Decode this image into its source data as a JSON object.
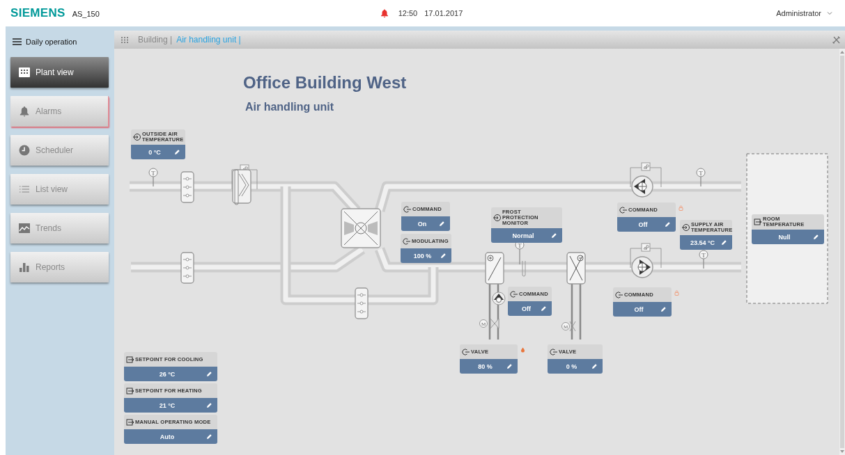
{
  "header": {
    "logo": "SIEMENS",
    "device": "AS_150",
    "time": "12:50",
    "date": "17.01.2017",
    "user": "Administrator"
  },
  "sidebar": {
    "title": "Daily operation",
    "items": [
      {
        "label": "Plant view",
        "selected": true,
        "alert": false
      },
      {
        "label": "Alarms",
        "selected": false,
        "alert": true
      },
      {
        "label": "Scheduler",
        "selected": false,
        "alert": false
      },
      {
        "label": "List view",
        "selected": false,
        "alert": false
      },
      {
        "label": "Trends",
        "selected": false,
        "alert": false
      },
      {
        "label": "Reports",
        "selected": false,
        "alert": false
      }
    ]
  },
  "breadcrumb": [
    {
      "label": "Building |",
      "current": false
    },
    {
      "label": "Air handling unit |",
      "current": true
    }
  ],
  "plant": {
    "title": "Office Building West",
    "subtitle": "Air handling unit",
    "sensor_marks": [
      "T",
      "T",
      "T",
      "T"
    ],
    "actuator_marks": [
      "M",
      "M"
    ],
    "datapoints": [
      {
        "kind": "sensor",
        "label": "OUTSIDE AIR TEMPERATURE",
        "value": "0 °C"
      },
      {
        "kind": "command",
        "label": "COMMAND",
        "value": "On"
      },
      {
        "kind": "command",
        "label": "MODULATING",
        "value": "100 %"
      },
      {
        "kind": "sensor",
        "label": "FROST PROTECTION MONITOR",
        "value": "Normal"
      },
      {
        "kind": "command",
        "label": "COMMAND",
        "value": "Off"
      },
      {
        "kind": "sensor",
        "label": "SUPPLY AIR TEMPERATURE",
        "value": "23.54 °C"
      },
      {
        "kind": "setpoint",
        "label": "ROOM TEMPERATURE",
        "value": "Null"
      },
      {
        "kind": "command",
        "label": "COMMAND",
        "value": "Off"
      },
      {
        "kind": "command",
        "label": "COMMAND",
        "value": "Off"
      },
      {
        "kind": "command",
        "label": "VALVE",
        "value": "80 %"
      },
      {
        "kind": "command",
        "label": "VALVE",
        "value": "0 %"
      },
      {
        "kind": "setpoint",
        "label": "SETPOINT FOR COOLING",
        "value": "26 °C"
      },
      {
        "kind": "setpoint",
        "label": "SETPOINT FOR HEATING",
        "value": "21 °C"
      },
      {
        "kind": "setpoint",
        "label": "MANUAL OPERATING MODE",
        "value": "Auto"
      }
    ]
  }
}
